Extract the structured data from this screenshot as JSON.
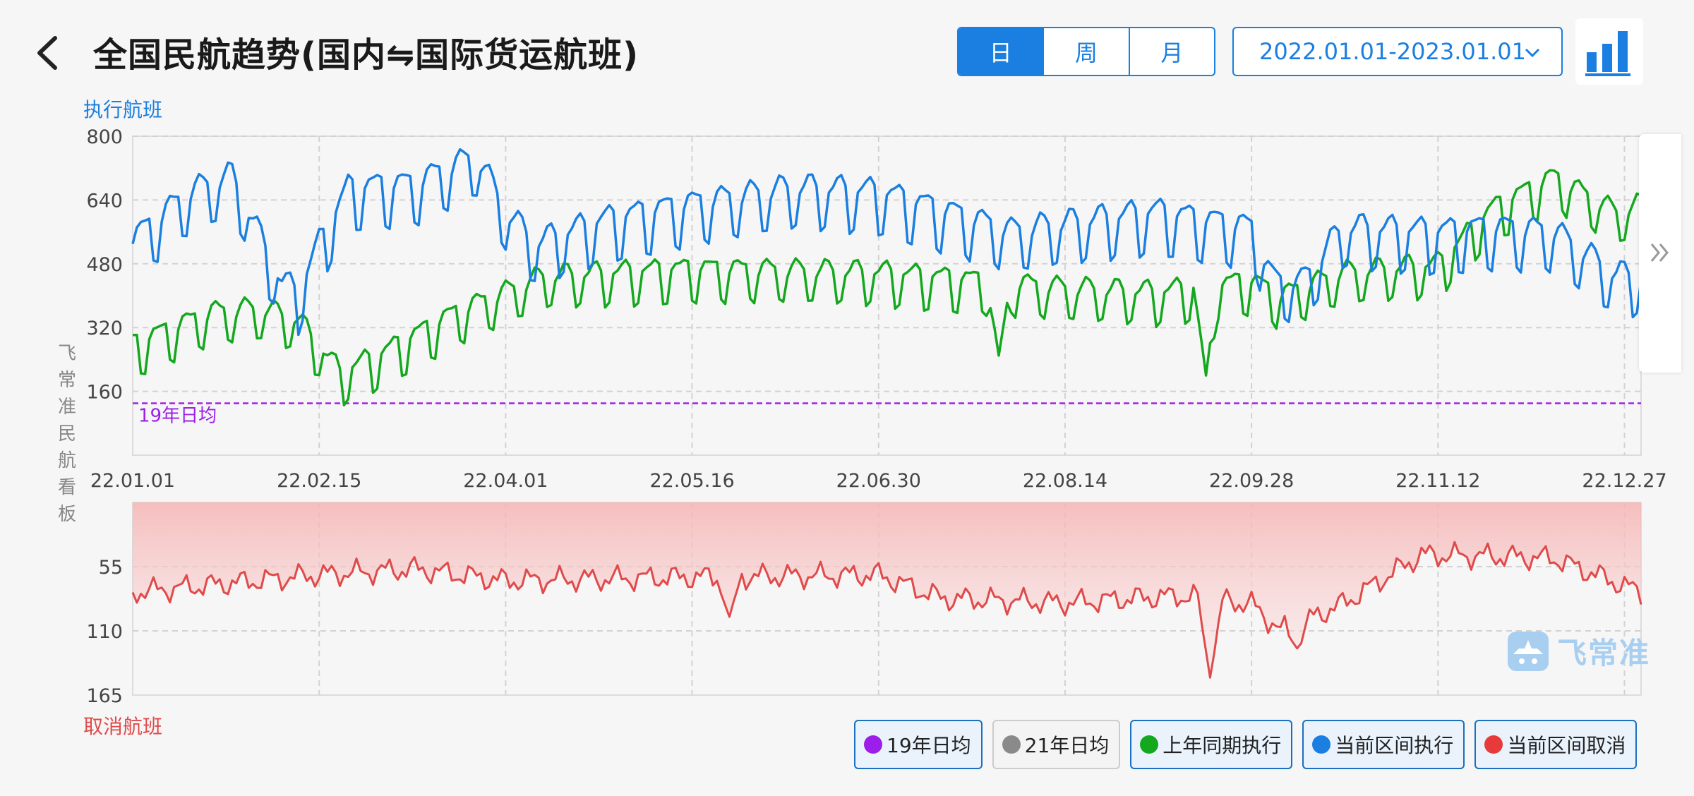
{
  "header": {
    "title": "全国民航趋势(国内⇋国际货运航班)",
    "granularity_tabs": [
      {
        "label": "日",
        "active": true
      },
      {
        "label": "周",
        "active": false
      },
      {
        "label": "月",
        "active": false
      }
    ],
    "date_range": "2022.01.01-2023.01.01"
  },
  "axis_titles": {
    "top": "执行航班",
    "bottom": "取消航班",
    "brand_vertical": "飞常准民航看板"
  },
  "legend": [
    {
      "label": "19年日均",
      "color": "#9b1fe8",
      "active": true
    },
    {
      "label": "21年日均",
      "color": "#8a8a8a",
      "active": false
    },
    {
      "label": "上年同期执行",
      "color": "#14a81e",
      "active": true
    },
    {
      "label": "当前区间执行",
      "color": "#1a7fe0",
      "active": true
    },
    {
      "label": "当前区间取消",
      "color": "#e83a3a",
      "active": true
    }
  ],
  "brand": {
    "name": "飞常准"
  },
  "colors": {
    "accent": "#1a7fe0",
    "current": "#1a7fe0",
    "last_year": "#14a81e",
    "cancel": "#e04a4a",
    "avg19": "#9b1fe8"
  },
  "chart_data": [
    {
      "type": "line",
      "ylabel": "执行航班",
      "ylim": [
        0,
        800
      ],
      "yticks": [
        160,
        320,
        480,
        640,
        800
      ],
      "x_range": [
        "2022-01-01",
        "2022-12-31"
      ],
      "xtick_labels": [
        "22.01.01",
        "22.02.15",
        "22.04.01",
        "22.05.16",
        "22.06.30",
        "22.08.14",
        "22.09.28",
        "22.11.12",
        "22.12.27"
      ],
      "grid": true,
      "reference_lines": [
        {
          "name": "19年日均",
          "value": 130
        }
      ],
      "series": [
        {
          "name": "当前区间执行",
          "color": "#1a7fe0",
          "anchors": [
            {
              "x": "2022-01-01",
              "y": 530
            },
            {
              "x": "2022-01-15",
              "y": 650
            },
            {
              "x": "2022-01-25",
              "y": 690
            },
            {
              "x": "2022-02-01",
              "y": 530
            },
            {
              "x": "2022-02-06",
              "y": 420
            },
            {
              "x": "2022-02-10",
              "y": 400
            },
            {
              "x": "2022-02-15",
              "y": 520
            },
            {
              "x": "2022-02-22",
              "y": 660
            },
            {
              "x": "2022-03-10",
              "y": 670
            },
            {
              "x": "2022-03-25",
              "y": 740
            },
            {
              "x": "2022-04-01",
              "y": 600
            },
            {
              "x": "2022-04-08",
              "y": 520
            },
            {
              "x": "2022-04-25",
              "y": 580
            },
            {
              "x": "2022-05-16",
              "y": 620
            },
            {
              "x": "2022-06-10",
              "y": 660
            },
            {
              "x": "2022-06-30",
              "y": 650
            },
            {
              "x": "2022-07-20",
              "y": 590
            },
            {
              "x": "2022-08-01",
              "y": 550
            },
            {
              "x": "2022-08-14",
              "y": 570
            },
            {
              "x": "2022-09-05",
              "y": 600
            },
            {
              "x": "2022-09-28",
              "y": 560
            },
            {
              "x": "2022-10-03",
              "y": 430
            },
            {
              "x": "2022-10-10",
              "y": 420
            },
            {
              "x": "2022-10-20",
              "y": 560
            },
            {
              "x": "2022-11-12",
              "y": 550
            },
            {
              "x": "2022-11-25",
              "y": 560
            },
            {
              "x": "2022-12-10",
              "y": 550
            },
            {
              "x": "2022-12-25",
              "y": 440
            },
            {
              "x": "2022-12-31",
              "y": 440
            }
          ]
        },
        {
          "name": "上年同期执行",
          "color": "#14a81e",
          "anchors": [
            {
              "x": "2022-01-01",
              "y": 270
            },
            {
              "x": "2022-01-20",
              "y": 350
            },
            {
              "x": "2022-02-01",
              "y": 360
            },
            {
              "x": "2022-02-10",
              "y": 330
            },
            {
              "x": "2022-02-20",
              "y": 200
            },
            {
              "x": "2022-03-01",
              "y": 240
            },
            {
              "x": "2022-03-20",
              "y": 350
            },
            {
              "x": "2022-04-01",
              "y": 400
            },
            {
              "x": "2022-04-10",
              "y": 440
            },
            {
              "x": "2022-05-16",
              "y": 460
            },
            {
              "x": "2022-06-30",
              "y": 450
            },
            {
              "x": "2022-07-25",
              "y": 430
            },
            {
              "x": "2022-08-14",
              "y": 410
            },
            {
              "x": "2022-09-05",
              "y": 400
            },
            {
              "x": "2022-09-28",
              "y": 430
            },
            {
              "x": "2022-10-05",
              "y": 390
            },
            {
              "x": "2022-10-20",
              "y": 450
            },
            {
              "x": "2022-11-12",
              "y": 470
            },
            {
              "x": "2022-11-25",
              "y": 610
            },
            {
              "x": "2022-12-10",
              "y": 690
            },
            {
              "x": "2022-12-25",
              "y": 600
            },
            {
              "x": "2022-12-31",
              "y": 620
            }
          ],
          "dips": [
            {
              "x": "2022-07-29",
              "y": 250
            },
            {
              "x": "2022-09-17",
              "y": 200
            }
          ]
        }
      ]
    },
    {
      "type": "area",
      "ylabel": "取消航班",
      "ylim": [
        165,
        0
      ],
      "inverted": true,
      "yticks": [
        55,
        110,
        165
      ],
      "x_range": [
        "2022-01-01",
        "2022-12-31"
      ],
      "grid": true,
      "series": [
        {
          "name": "当前区间取消",
          "color": "#e04a4a",
          "anchors": [
            {
              "x": "2022-01-01",
              "y": 77
            },
            {
              "x": "2022-02-15",
              "y": 62
            },
            {
              "x": "2022-03-10",
              "y": 57
            },
            {
              "x": "2022-04-01",
              "y": 67
            },
            {
              "x": "2022-05-16",
              "y": 64
            },
            {
              "x": "2022-06-30",
              "y": 62
            },
            {
              "x": "2022-07-15",
              "y": 82
            },
            {
              "x": "2022-08-14",
              "y": 86
            },
            {
              "x": "2022-09-10",
              "y": 80
            },
            {
              "x": "2022-09-28",
              "y": 87
            },
            {
              "x": "2022-10-05",
              "y": 110
            },
            {
              "x": "2022-10-20",
              "y": 87
            },
            {
              "x": "2022-11-08",
              "y": 45
            },
            {
              "x": "2022-11-25",
              "y": 46
            },
            {
              "x": "2022-12-10",
              "y": 48
            },
            {
              "x": "2022-12-31",
              "y": 77
            }
          ],
          "spikes": [
            {
              "x": "2022-09-18",
              "y": 150
            },
            {
              "x": "2022-10-09",
              "y": 125
            },
            {
              "x": "2022-05-25",
              "y": 98
            }
          ]
        }
      ]
    }
  ]
}
